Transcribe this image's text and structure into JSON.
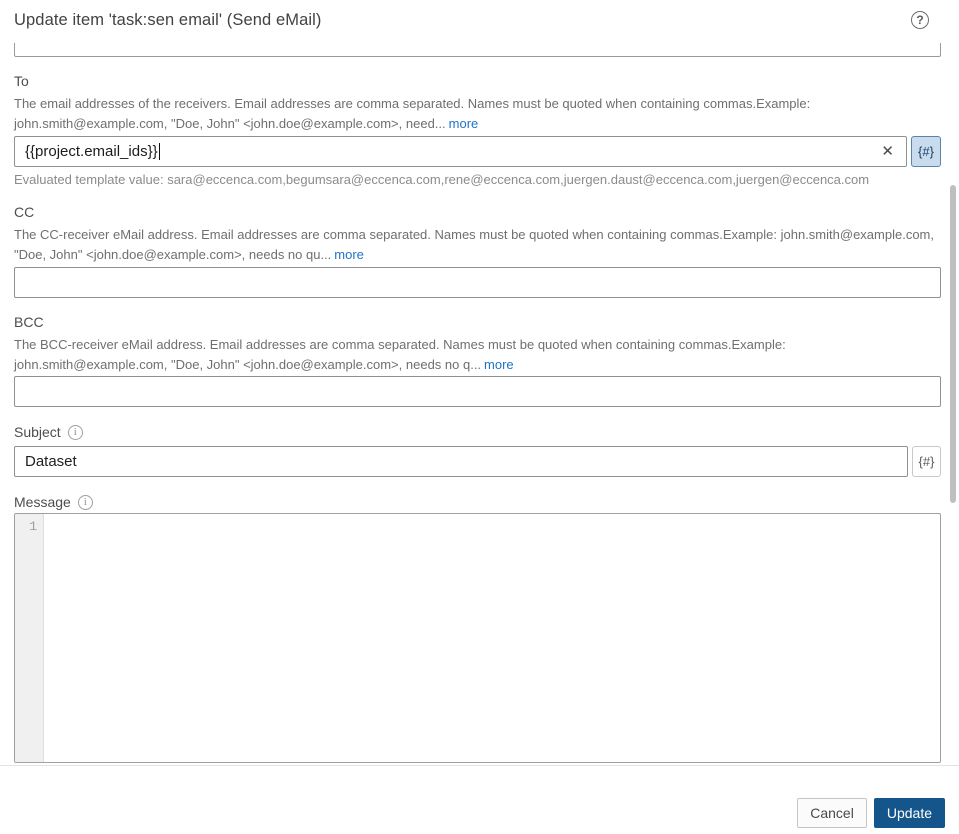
{
  "header": {
    "title": "Update item 'task:sen email' (Send eMail)"
  },
  "icons": {
    "help": "?",
    "info": "i",
    "clear": "✕",
    "template": "{#}"
  },
  "to": {
    "label": "To",
    "description": "The email addresses of the receivers. Email addresses are comma separated. Names must be quoted when containing commas.Example: john.smith@example.com, \"Doe, John\" <john.doe@example.com>, need...",
    "more": "more",
    "value": "{{project.email_ids}}",
    "evaluated": "Evaluated template value: sara@eccenca.com,begumsara@eccenca.com,rene@eccenca.com,juergen.daust@eccenca.com,juergen@eccenca.com"
  },
  "cc": {
    "label": "CC",
    "description": "The CC-receiver eMail address. Email addresses are comma separated. Names must be quoted when containing commas.Example: john.smith@example.com, \"Doe, John\" <john.doe@example.com>, needs no qu...",
    "more": "more",
    "value": ""
  },
  "bcc": {
    "label": "BCC",
    "description": "The BCC-receiver eMail address. Email addresses are comma separated. Names must be quoted when containing commas.Example: john.smith@example.com, \"Doe, John\" <john.doe@example.com>, needs no q...",
    "more": "more",
    "value": ""
  },
  "subject": {
    "label": "Subject",
    "value": "Dataset"
  },
  "message": {
    "label": "Message",
    "line_number": "1",
    "value": ""
  },
  "footer": {
    "cancel": "Cancel",
    "update": "Update"
  },
  "colors": {
    "primary": "#14568c",
    "link": "#2273c4",
    "template_active_bg": "#c9dcee",
    "template_active_border": "#5c84ab",
    "input_border": "#919191"
  }
}
